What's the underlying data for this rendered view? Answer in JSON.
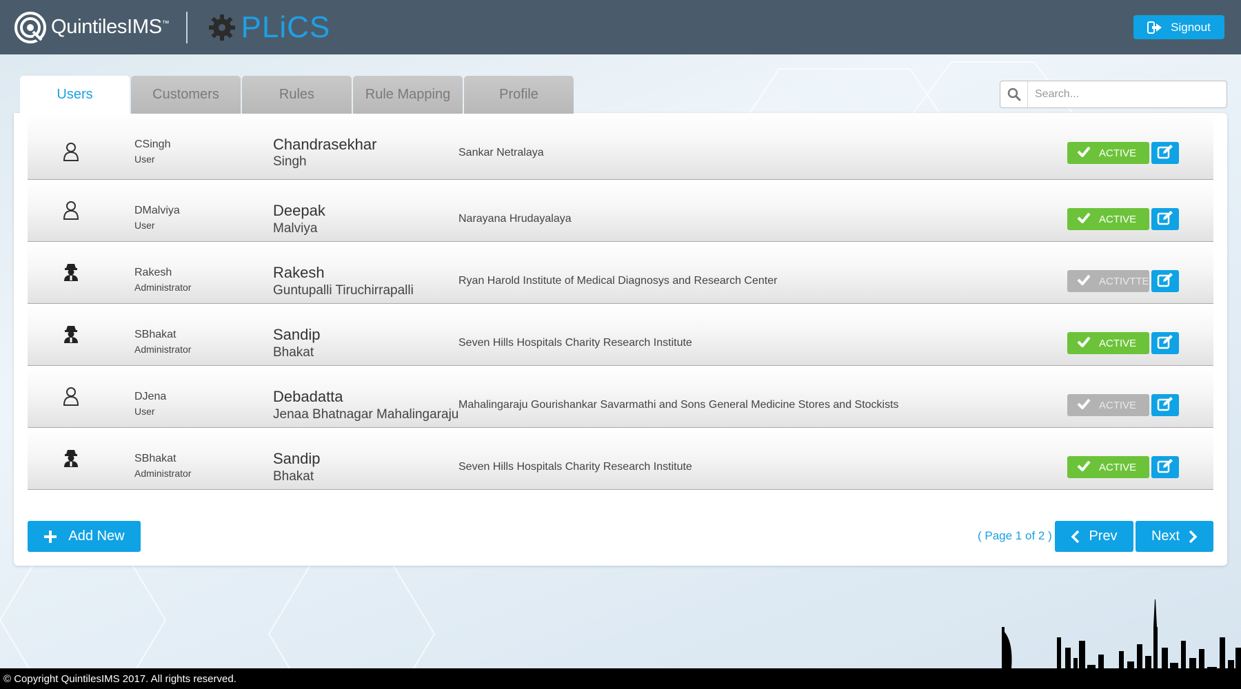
{
  "header": {
    "brand": "QuintilesIMS",
    "brand_tm": "™",
    "app_name": "PLiCS",
    "signout_label": "Signout"
  },
  "tabs": [
    {
      "label": "Users",
      "active": true
    },
    {
      "label": "Customers",
      "active": false
    },
    {
      "label": "Rules",
      "active": false
    },
    {
      "label": "Rule Mapping",
      "active": false
    },
    {
      "label": "Profile",
      "active": false
    }
  ],
  "search": {
    "placeholder": "Search...",
    "value": ""
  },
  "users": [
    {
      "username": "CSingh",
      "role": "User",
      "first_name": "Chandrasekhar",
      "last_name": "Singh",
      "organization": "Sankar Netralaya",
      "status": "ACTIVE",
      "status_state": "on",
      "icon": "user-outline-icon"
    },
    {
      "username": "DMalviya",
      "role": "User",
      "first_name": "Deepak",
      "last_name": "Malviya",
      "organization": "Narayana Hrudayalaya",
      "status": "ACTIVE",
      "status_state": "on",
      "icon": "user-outline-icon"
    },
    {
      "username": "Rakesh",
      "role": "Administrator",
      "first_name": "Rakesh",
      "last_name": "Guntupalli Tiruchirrapalli",
      "organization": "Ryan Harold Institute of Medical Diagnosys and Research Center",
      "status": "ACTIVTTE",
      "status_state": "off",
      "icon": "admin-user-icon"
    },
    {
      "username": "SBhakat",
      "role": "Administrator",
      "first_name": "Sandip",
      "last_name": "Bhakat",
      "organization": "Seven Hills Hospitals Charity Research Institute",
      "status": "ACTIVE",
      "status_state": "on",
      "icon": "admin-user-icon"
    },
    {
      "username": "DJena",
      "role": "User",
      "first_name": "Debadatta",
      "last_name": "Jenaa Bhatnagar Mahalingaraju",
      "organization": "Mahalingaraju Gourishankar Savarmathi and Sons General Medicine Stores and Stockists",
      "status": "ACTIVE",
      "status_state": "off",
      "icon": "user-outline-icon"
    },
    {
      "username": "SBhakat",
      "role": "Administrator",
      "first_name": "Sandip",
      "last_name": "Bhakat",
      "organization": "Seven Hills Hospitals Charity Research Institute",
      "status": "ACTIVE",
      "status_state": "on",
      "icon": "admin-user-icon"
    }
  ],
  "actions": {
    "add_new_label": "Add New"
  },
  "pagination": {
    "page_info": "( Page 1 of 2 )",
    "prev_label": "Prev",
    "next_label": "Next"
  },
  "footer": {
    "copyright": "© Copyright QuintilesIMS 2017. All rights reserved."
  },
  "colors": {
    "accent": "#0fa2e4",
    "active_green": "#6cc33a",
    "inactive_gray": "#b3b3b3",
    "header_bg": "#4a5c6b"
  }
}
